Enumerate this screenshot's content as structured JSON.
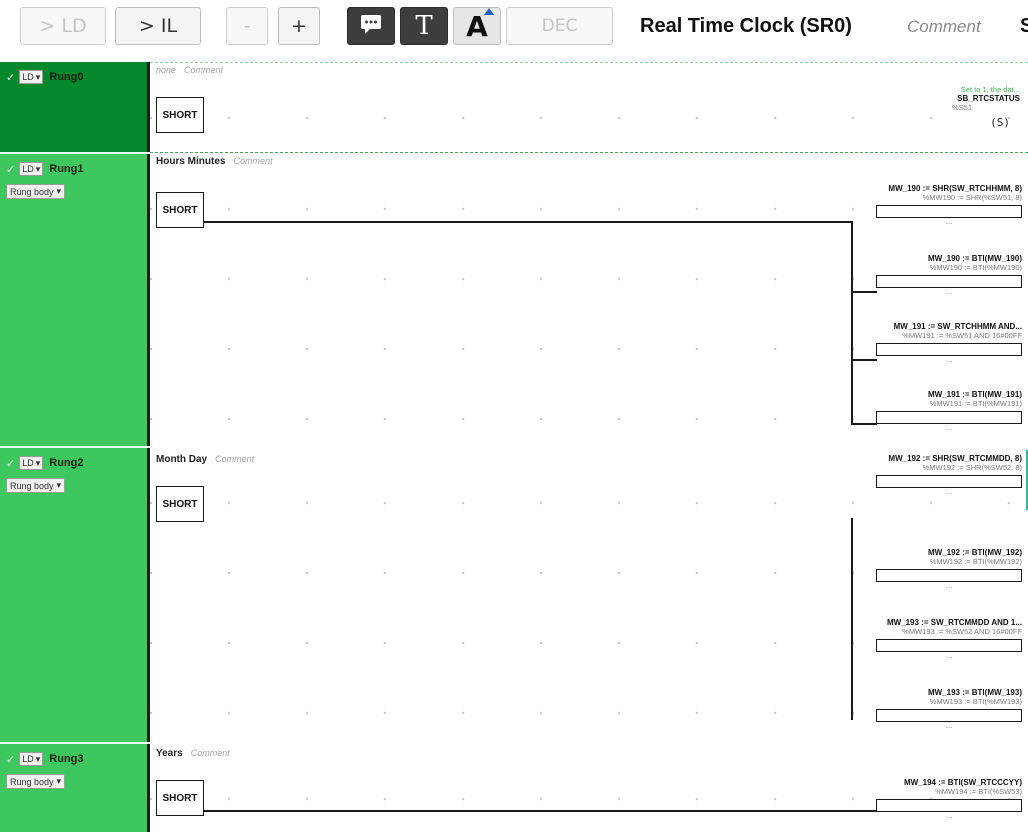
{
  "toolbar": {
    "ld_label": "> LD",
    "il_label": "> IL",
    "minus_label": "-",
    "plus_label": "+",
    "text_label": "T",
    "font_label": "A",
    "dec_label": "DEC",
    "title": "Real Time Clock (SR0)",
    "comment_placeholder": "Comment",
    "edge_char": "S"
  },
  "rungs": [
    {
      "name": "Rung0",
      "mode": "LD",
      "title": "none",
      "comment": "Comment",
      "contact": "SHORT",
      "coil": {
        "comment": "Set to 1, the dat...",
        "symbol": "SB_RTCSTATUS",
        "address": "%S51",
        "shape": "(S)"
      }
    },
    {
      "name": "Rung1",
      "mode": "LD",
      "body_select": "Rung body",
      "title": "Hours Minutes",
      "comment": "Comment",
      "contact": "SHORT",
      "operations": [
        {
          "title": "MW_190 := SHR(SW_RTCHHMM, 8)",
          "sub": "%MW190 := SHR(%SW51, 8)",
          "dots": "..."
        },
        {
          "title": "MW_190 := BTI(MW_190)",
          "sub": "%MW190 := BTI(%MW190)",
          "dots": "..."
        },
        {
          "title": "MW_191 := SW_RTCHHMM AND...",
          "sub": "%MW191 := %SW51 AND 16#00FF",
          "dots": "..."
        },
        {
          "title": "MW_191 := BTI(MW_191)",
          "sub": "%MW191 := BTI(%MW191)",
          "dots": "..."
        }
      ]
    },
    {
      "name": "Rung2",
      "mode": "LD",
      "body_select": "Rung body",
      "title": "Month Day",
      "comment": "Comment",
      "contact": "SHORT",
      "operations": [
        {
          "title": "MW_192 := SHR(SW_RTCMMDD, 8)",
          "sub": "%MW192 := SHR(%SW52, 8)",
          "dots": "..."
        },
        {
          "title": "MW_192 := BTI(MW_192)",
          "sub": "%MW192 := BTI(%MW192)",
          "dots": "..."
        },
        {
          "title": "MW_193 := SW_RTCMMDD AND 1...",
          "sub": "%MW193 := %SW52 AND 16#00FF",
          "dots": "..."
        },
        {
          "title": "MW_193 := BTI(MW_193)",
          "sub": "%MW193 := BTI(%MW193)",
          "dots": "..."
        }
      ]
    },
    {
      "name": "Rung3",
      "mode": "LD",
      "body_select": "Rung body",
      "title": "Years",
      "comment": "Comment",
      "contact": "SHORT",
      "operations": [
        {
          "title": "MW_194 := BTI(SW_RTCCCYY)",
          "sub": "%MW194 := BTI(%SW53)",
          "dots": "..."
        }
      ]
    }
  ],
  "colors": {
    "rung_selected": "#03892b",
    "rung_normal": "#3ec75e",
    "wire": "#1a1a1a"
  }
}
